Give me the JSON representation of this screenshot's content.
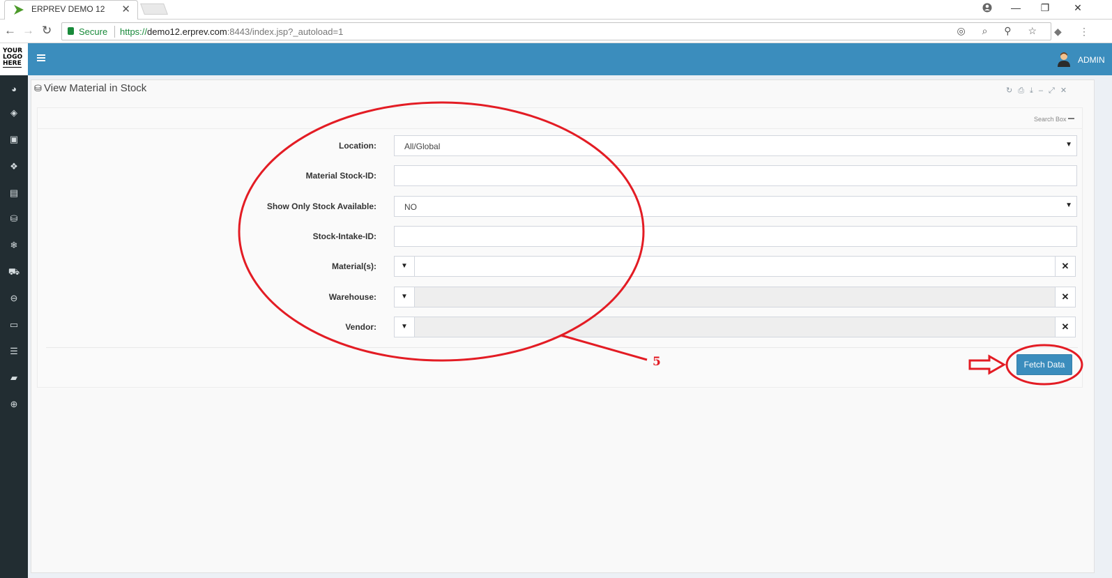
{
  "browser": {
    "tab_title": "ERPREV DEMO 12",
    "tab_close": "✕",
    "secure_label": "Secure",
    "url_scheme": "https://",
    "url_host": "demo12.erprev.com",
    "url_rest": ":8443/index.jsp?_autoload=1",
    "minimize": "—",
    "maximize": "❐",
    "close": "✕"
  },
  "header": {
    "logo_lines": [
      "YOUR",
      "LOGO",
      "HERE"
    ],
    "user": "ADMIN",
    "accent_color": "#3b8dbd"
  },
  "sidebar": {
    "icons": [
      "dashboard-icon",
      "tag-icon",
      "money-icon",
      "cubes-icon",
      "building-icon",
      "database-cup-icon",
      "snowflake-icon",
      "cart-icon",
      "circle-minus-icon",
      "monitor-icon",
      "stack-icon",
      "book-icon",
      "lifebuoy-icon"
    ]
  },
  "panel": {
    "title": "View Material in Stock",
    "search_box_label": "Search Box"
  },
  "form": {
    "location_label": "Location:",
    "location_value": "All/Global",
    "stock_id_label": "Material Stock-ID:",
    "stock_id_value": "",
    "show_only_label": "Show Only Stock Available:",
    "show_only_value": "NO",
    "intake_label": "Stock-Intake-ID:",
    "intake_value": "",
    "materials_label": "Material(s):",
    "warehouse_label": "Warehouse:",
    "vendor_label": "Vendor:",
    "fetch_button": "Fetch Data"
  },
  "annotation": {
    "number": "5",
    "color": "#e31c24"
  }
}
